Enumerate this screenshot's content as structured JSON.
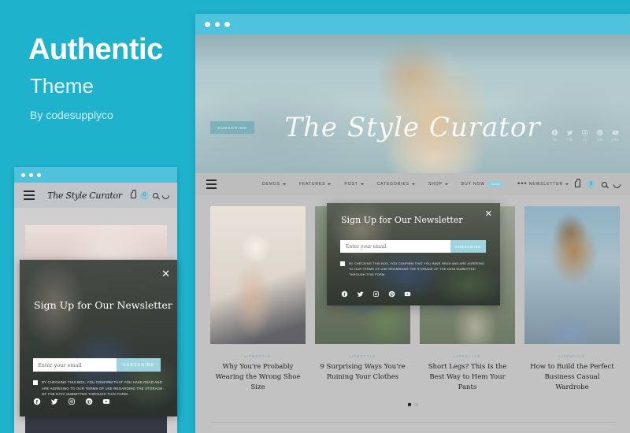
{
  "promo": {
    "title": "Authentic",
    "subtitle": "Theme",
    "byline": "By codesupplyco",
    "accent_color": "#1FB2CD"
  },
  "mobile_preview": {
    "titlebar_color": "#4FC3DB",
    "header": {
      "menu_icon": "hamburger-icon",
      "logo": "The Style Curator",
      "cart_icon": "shopping-bag-icon",
      "cart_count": "0",
      "search_icon": "search-icon",
      "darkmode_icon": "moon-icon"
    },
    "popup": {
      "title": "Sign Up for Our Newsletter",
      "close_icon": "close-icon",
      "email_placeholder": "Enter your email",
      "email_value": "",
      "subscribe_label": "SUBSCRIBE",
      "consent_text": "BY CHECKING THIS BOX, YOU CONFIRM THAT YOU HAVE READ AND ARE AGREEING TO OUR TERMS OF USE REGARDING THE STORAGE OF THE DATA SUBMITTED THROUGH THIS FORM.",
      "social": [
        "facebook-icon",
        "twitter-icon",
        "instagram-icon",
        "pinterest-icon",
        "youtube-icon"
      ]
    }
  },
  "desktop_preview": {
    "titlebar_color": "#4FC3DB",
    "hero": {
      "subscribe_label": "SUBSCRIBE",
      "logo": "The Style Curator",
      "social": [
        {
          "icon": "facebook-icon",
          "count": "22"
        },
        {
          "icon": "twitter-icon",
          "count": "76k"
        },
        {
          "icon": "instagram-icon",
          "count": "41"
        },
        {
          "icon": "pinterest-icon",
          "count": "13k"
        },
        {
          "icon": "youtube-icon",
          "count": "170k"
        }
      ]
    },
    "nav": {
      "menu_icon": "hamburger-icon",
      "links": [
        {
          "label": "DEMOS",
          "caret": true
        },
        {
          "label": "FEATURES",
          "caret": true
        },
        {
          "label": "POST",
          "caret": true
        },
        {
          "label": "CATEGORIES",
          "caret": true
        },
        {
          "label": "SHOP",
          "caret": true
        },
        {
          "label": "BUY NOW",
          "caret": false,
          "badge": "SALE"
        }
      ],
      "more_icon": "ellipsis-icon",
      "right": {
        "newsletter_label": "NEWSLETTER",
        "cart_icon": "shopping-bag-icon",
        "cart_count": "0",
        "search_icon": "search-icon",
        "darkmode_icon": "moon-icon"
      }
    },
    "cards": [
      {
        "category": "LIFESTYLE",
        "title": "Why You're Probably Wearing the Wrong Shoe Size",
        "image": "hands-holding-coffee-cup"
      },
      {
        "category": "LIFESTYLE",
        "title": "9 Surprising Ways You're Ruining Your Clothes",
        "image": "dog-in-plaid-sweater"
      },
      {
        "category": "LIFESTYLE",
        "title": "Short Legs? This Is the Best Way to Hem Your Pants",
        "image": "outdoor-garden-scene"
      },
      {
        "category": "LIFESTYLE",
        "title": "How to Build the Perfect Business Casual Wardrobe",
        "image": "woman-hair-bun-from-behind"
      }
    ],
    "pagination": {
      "total": 2,
      "active": 1
    },
    "popup": {
      "title": "Sign Up for Our Newsletter",
      "close_icon": "close-icon",
      "email_placeholder": "Enter your email",
      "email_value": "",
      "subscribe_label": "SUBSCRIBE",
      "consent_text": "BY CHECKING THIS BOX, YOU CONFIRM THAT YOU HAVE READ AND ARE AGREEING TO OUR TERMS OF USE REGARDING THE STORAGE OF THE DATA SUBMITTED THROUGH THIS FORM.",
      "social": [
        "facebook-icon",
        "twitter-icon",
        "instagram-icon",
        "pinterest-icon",
        "youtube-icon"
      ]
    }
  }
}
